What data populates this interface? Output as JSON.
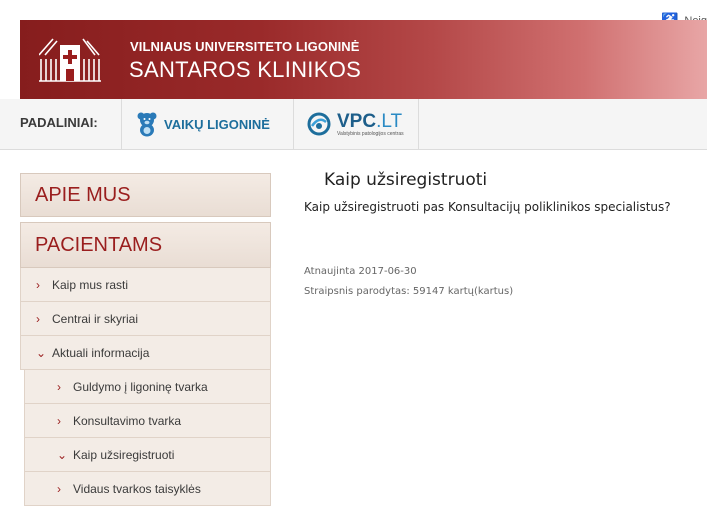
{
  "header": {
    "accessibility_label": "Neįg",
    "brand_top": "VILNIAUS UNIVERSITETO LIGONINĖ",
    "brand_main": "SANTAROS KLINIKOS"
  },
  "subnav": {
    "label": "PADALINIAI:",
    "vaiku_label": "VAIKŲ LIGONINĖ",
    "vpc_title": "VPC",
    "vpc_suffix": ".LT",
    "vpc_sub": "Valstybinis patologijos centras"
  },
  "sidebar": {
    "apie_mus": "APIE MUS",
    "pacientams": "PACIENTAMS",
    "items": [
      {
        "label": "Kaip mus rasti"
      },
      {
        "label": "Centrai ir skyriai"
      },
      {
        "label": "Aktuali informacija"
      }
    ],
    "subitems": [
      {
        "label": "Guldymo į ligoninę tvarka"
      },
      {
        "label": "Konsultavimo tvarka"
      },
      {
        "label": "Kaip užsiregistruoti"
      },
      {
        "label": "Vidaus tvarkos taisyklės"
      }
    ]
  },
  "content": {
    "title": "Kaip užsiregistruoti",
    "lead": "Kaip užsiregistruoti pas Konsultacijų poliklinikos specialistus?",
    "updated": "Atnaujinta 2017-06-30",
    "views": "Straipsnis parodytas: 59147 kartų(kartus)"
  },
  "colors": {
    "brand_red": "#9a1e1e",
    "link_blue": "#1d6e9c"
  },
  "icons": {
    "accessibility": "wheelchair-icon",
    "logo": "santaros-logo-icon",
    "vaiku": "teddy-bear-icon",
    "vpc": "vpc-logo-icon",
    "chevron_right": "chevron-right-icon",
    "chevron_down": "chevron-down-icon"
  }
}
